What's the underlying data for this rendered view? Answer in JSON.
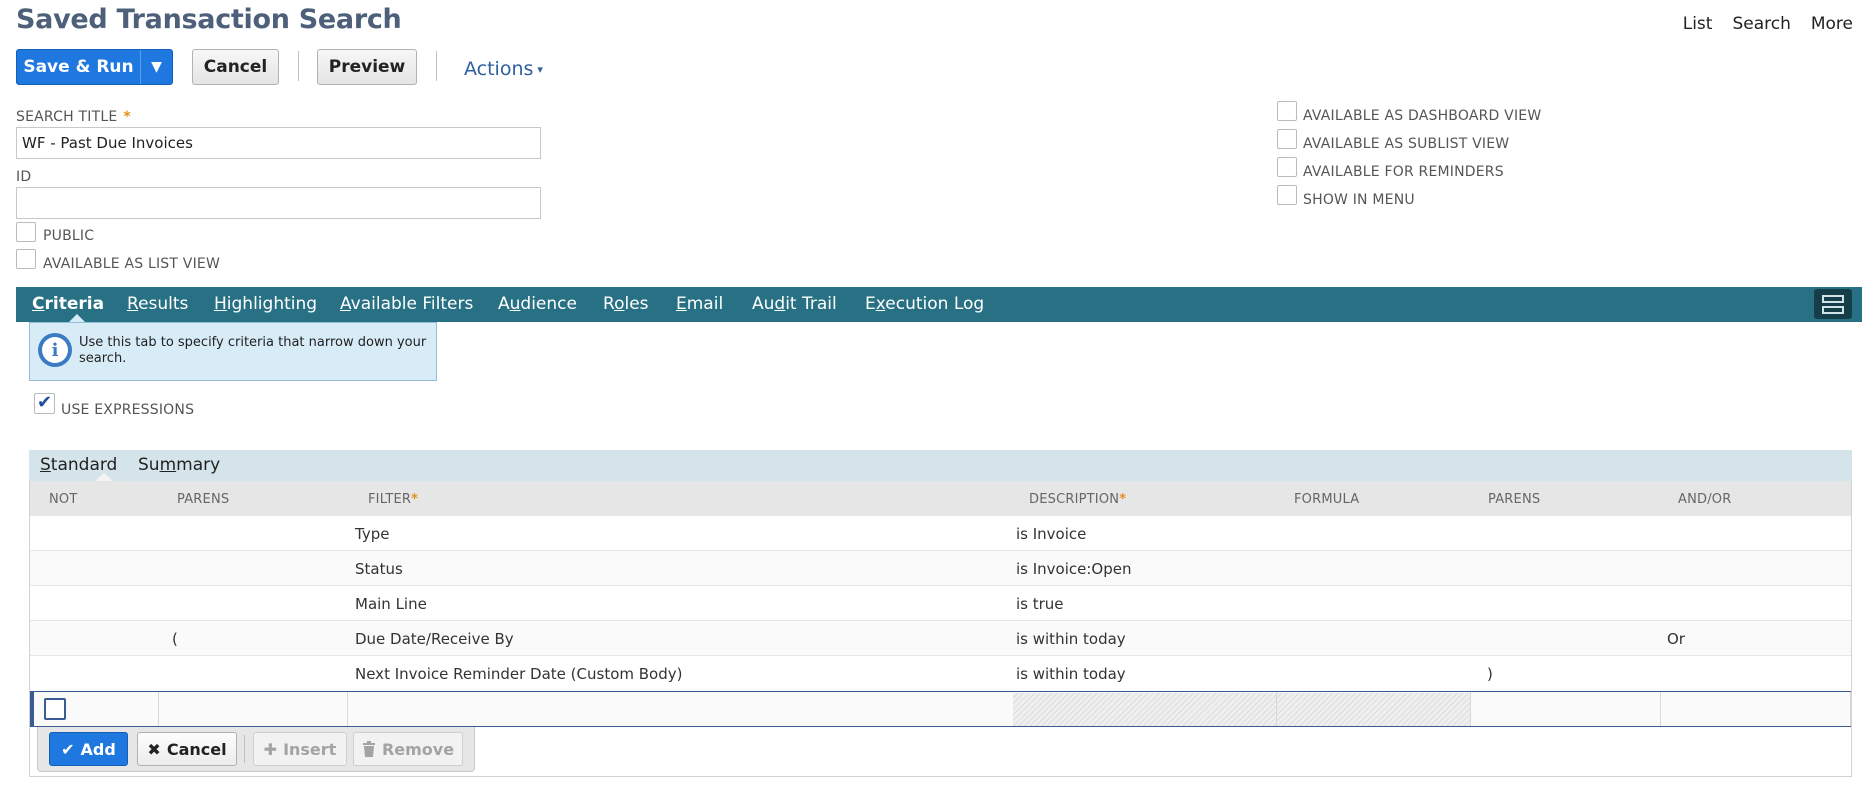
{
  "header": {
    "title": "Saved Transaction Search",
    "links": [
      "List",
      "Search",
      "More"
    ]
  },
  "toolbar": {
    "save_run": "Save & Run",
    "save_run_caret": "▼",
    "cancel": "Cancel",
    "preview": "Preview",
    "actions": "Actions",
    "actions_caret": "▾"
  },
  "form": {
    "search_title_label": "SEARCH TITLE",
    "required_mark": "*",
    "search_title_value": "WF - Past Due Invoices",
    "id_label": "ID",
    "id_value": "",
    "public_label": "PUBLIC",
    "list_view_label": "AVAILABLE AS LIST VIEW",
    "right_options": [
      "AVAILABLE AS DASHBOARD VIEW",
      "AVAILABLE AS SUBLIST VIEW",
      "AVAILABLE FOR REMINDERS",
      "SHOW IN MENU"
    ]
  },
  "tabs": [
    {
      "pre": "",
      "ul": "C",
      "post": "riteria"
    },
    {
      "pre": "",
      "ul": "R",
      "post": "esults"
    },
    {
      "pre": "",
      "ul": "H",
      "post": "ighlighting"
    },
    {
      "pre": "",
      "ul": "A",
      "post": "vailable Filters"
    },
    {
      "pre": "A",
      "ul": "u",
      "post": "dience"
    },
    {
      "pre": "R",
      "ul": "o",
      "post": "les"
    },
    {
      "pre": "",
      "ul": "E",
      "post": "mail"
    },
    {
      "pre": "Au",
      "ul": "d",
      "post": "it Trail"
    },
    {
      "pre": "E",
      "ul": "x",
      "post": "ecution Log"
    }
  ],
  "info": {
    "text": "Use this tab to specify criteria that narrow down your search."
  },
  "use_expressions": {
    "label": "USE EXPRESSIONS",
    "checkmark": "✔"
  },
  "subtabs": [
    {
      "pre": "",
      "ul": "S",
      "post": "tandard"
    },
    {
      "pre": "Su",
      "ul": "m",
      "post": "mary"
    }
  ],
  "grid": {
    "columns": [
      "NOT",
      "PARENS",
      "FILTER",
      "DESCRIPTION",
      "FORMULA",
      "PARENS",
      "AND/OR"
    ],
    "rows": [
      {
        "not": "",
        "parens_open": "",
        "filter": "Type",
        "description": "is Invoice",
        "formula": "",
        "parens_close": "",
        "andor": ""
      },
      {
        "not": "",
        "parens_open": "",
        "filter": "Status",
        "description": "is Invoice:Open",
        "formula": "",
        "parens_close": "",
        "andor": ""
      },
      {
        "not": "",
        "parens_open": "",
        "filter": "Main Line",
        "description": "is true",
        "formula": "",
        "parens_close": "",
        "andor": ""
      },
      {
        "not": "",
        "parens_open": "(",
        "filter": "Due Date/Receive By",
        "description": "is within today",
        "formula": "",
        "parens_close": "",
        "andor": "Or"
      },
      {
        "not": "",
        "parens_open": "",
        "filter": "Next Invoice Reminder Date (Custom Body)",
        "description": "is within today",
        "formula": "",
        "parens_close": ")",
        "andor": ""
      }
    ]
  },
  "sublist_buttons": {
    "add": "Add",
    "cancel": "Cancel",
    "insert": "Insert",
    "remove": "Remove"
  }
}
